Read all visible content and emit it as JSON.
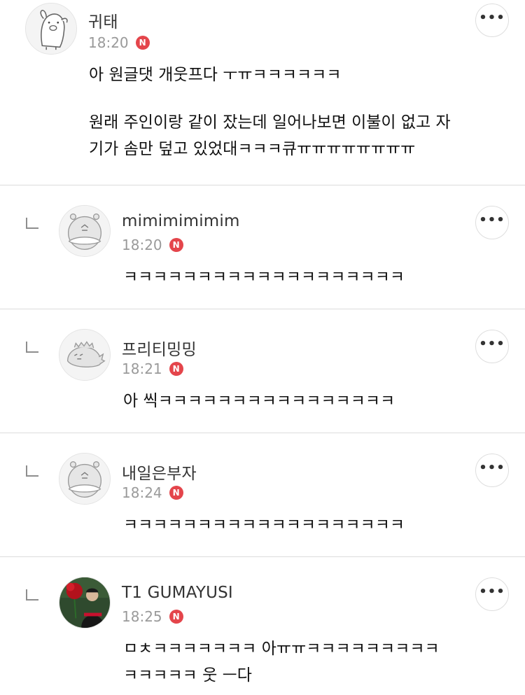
{
  "comments": [
    {
      "nickname": "귀태",
      "time": "18:20",
      "badge": "N",
      "lines": [
        "아 원글댓 개웃프다 ㅜㅠㅋㅋㅋㅋㅋㅋ",
        "",
        "원래 주인이랑 같이 잤는데 일어나보면 이불이 없고 자",
        "기가 솜만 덮고 있었대ㅋㅋㅋ큐ㅠㅠㅠㅠㅠㅠㅠㅠ"
      ],
      "avatar": "pig-avatar"
    },
    {
      "nickname": "mimimimimim",
      "time": "18:20",
      "badge": "N",
      "lines": [
        "ㅋㅋㅋㅋㅋㅋㅋㅋㅋㅋㅋㅋㅋㅋㅋㅋㅋㅋㅋ"
      ],
      "avatar": "hippo-avatar"
    },
    {
      "nickname": "프리티밍밍",
      "time": "18:21",
      "badge": "N",
      "lines": [
        "아 씩ㅋㅋㅋㅋㅋㅋㅋㅋㅋㅋㅋㅋㅋㅋㅋㅋ"
      ],
      "avatar": "dino-avatar"
    },
    {
      "nickname": "내일은부자",
      "time": "18:24",
      "badge": "N",
      "lines": [
        "ㅋㅋㅋㅋㅋㅋㅋㅋㅋㅋㅋㅋㅋㅋㅋㅋㅋㅋㅋ"
      ],
      "avatar": "hippo-avatar"
    },
    {
      "nickname": "T1 GUMAYUSI",
      "time": "18:25",
      "badge": "N",
      "lines": [
        "ㅁㅊㅋㅋㅋㅋㅋㅋㅋ 아ㅠㅠㅋㅋㅋㅋㅋㅋㅋㅋㅋ",
        "ㅋㅋㅋㅋㅋ 웃 ㅡ다"
      ],
      "avatar": "photo-avatar"
    }
  ],
  "more_label": "•••",
  "colors": {
    "badge": "#e4454b",
    "divider": "#dcdcdc",
    "time": "#9a9a9a"
  }
}
